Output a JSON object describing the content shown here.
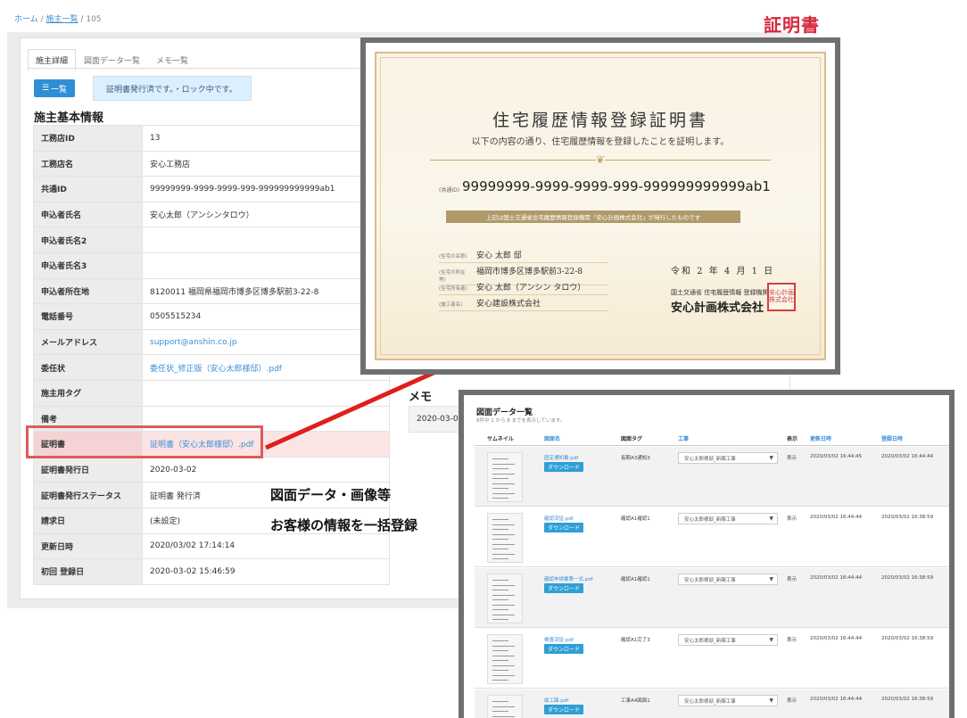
{
  "breadcrumb": {
    "home": "ホーム",
    "sep": "/",
    "list": "施主一覧",
    "current": "105"
  },
  "tabs": [
    "施主詳細",
    "図面データ一覧",
    "メモ一覧"
  ],
  "list_button": "一覧",
  "status_message": "証明書発行済です。・ロック中です。",
  "section_title": "施主基本情報",
  "info_rows": [
    {
      "label": "工務店ID",
      "value": "13"
    },
    {
      "label": "工務店名",
      "value": "安心工務店"
    },
    {
      "label": "共通ID",
      "value": "99999999-9999-9999-999-999999999999ab1"
    },
    {
      "label": "申込者氏名",
      "value": "安心太郎（アンシンタロウ）"
    },
    {
      "label": "申込者氏名2",
      "value": ""
    },
    {
      "label": "申込者氏名3",
      "value": ""
    },
    {
      "label": "申込者所在地",
      "value": "8120011 福岡県福岡市博多区博多駅前3-22-8"
    },
    {
      "label": "電話番号",
      "value": "0505515234"
    },
    {
      "label": "メールアドレス",
      "value": "support@anshin.co.jp"
    },
    {
      "label": "委任状",
      "value": "委任状_修正版（安心太郎様邸）.pdf"
    },
    {
      "label": "施主用タグ",
      "value": ""
    },
    {
      "label": "備考",
      "value": ""
    },
    {
      "label": "証明書",
      "value": "証明書（安心太郎様邸）.pdf"
    },
    {
      "label": "証明書発行日",
      "value": "2020-03-02"
    },
    {
      "label": "証明書発行ステータス",
      "value": "証明書 発行済"
    },
    {
      "label": "請求日",
      "value": "(未設定)"
    },
    {
      "label": "更新日時",
      "value": "2020/03/02 17:14:14"
    },
    {
      "label": "初回 登録日",
      "value": "2020-03-02 15:46:59"
    }
  ],
  "memo": {
    "title": "メモ",
    "date": "2020-03-02"
  },
  "callout": {
    "line1": "図面データ・画像等",
    "line2": "お客様の情報を一括登録"
  },
  "certificate": {
    "label": "証明書",
    "title": "住宅履歴情報登録証明書",
    "subtitle": "以下の内容の通り、住宅履歴情報を登録したことを証明します。",
    "id_label": "(共通ID)",
    "id": "99999999-9999-9999-999-999999999999ab1",
    "ribbon": "上記は国土交通省住宅履歴情報登録機関「安心計画株式会社」が発行したものです",
    "fields": [
      {
        "label": "(住宅の名称)",
        "value": "安心 太郎 邸"
      },
      {
        "label": "(住宅の所在地)",
        "value": "福岡市博多区博多駅前3-22-8"
      },
      {
        "label": "(住宅所有者)",
        "value": "安心 太郎（アンシン タロウ）"
      },
      {
        "label": "(施工者名)",
        "value": "安心建設株式会社"
      }
    ],
    "date": "令和 2 年 4 月 1 日",
    "issuer_small": "国土交通省 住宅履歴情報 登録機関",
    "issuer": "安心計画株式会社",
    "seal": "安心計画株式会社"
  },
  "drawing_list": {
    "title": "図面データ一覧",
    "count": "8件中 1 から 8 までを表示しています。",
    "headers": [
      "サムネイル",
      "図面名",
      "図面タグ",
      "工事",
      "表示",
      "更新日時",
      "登録日時"
    ],
    "download_label": "ダウンロード",
    "rows": [
      {
        "file": "固定通知書.pdf",
        "tag": "長期A3通知3",
        "project": "安心太郎様邸_新築工事",
        "display": "表示",
        "updated": "2020/03/02 16:44:45",
        "created": "2020/03/02 16:44:44"
      },
      {
        "file": "確認済証.pdf",
        "tag": "確認A1確認1",
        "project": "安心太郎様邸_新築工事",
        "display": "表示",
        "updated": "2020/03/02 16:44:44",
        "created": "2020/03/02 16:38:59"
      },
      {
        "file": "確認申請書第一式.pdf",
        "tag": "確認A1確認1",
        "project": "安心太郎様邸_新築工事",
        "display": "表示",
        "updated": "2020/03/02 16:44:44",
        "created": "2020/03/02 16:38:59"
      },
      {
        "file": "検査済証.pdf",
        "tag": "確認A1完了3",
        "project": "安心太郎様邸_新築工事",
        "display": "表示",
        "updated": "2020/03/02 16:44:44",
        "created": "2020/03/02 16:38:59"
      },
      {
        "file": "竣工図.pdf",
        "tag": "工事A4図面1",
        "project": "安心太郎様邸_新築工事",
        "display": "表示",
        "updated": "2020/03/02 16:44:44",
        "created": "2020/03/02 16:38:59"
      }
    ]
  },
  "colors": {
    "accent": "#2f8fd6",
    "link": "#3b8ed6",
    "highlight": "#e05a5a",
    "connector": "#e01e1e",
    "cert_label": "#d7263d"
  }
}
